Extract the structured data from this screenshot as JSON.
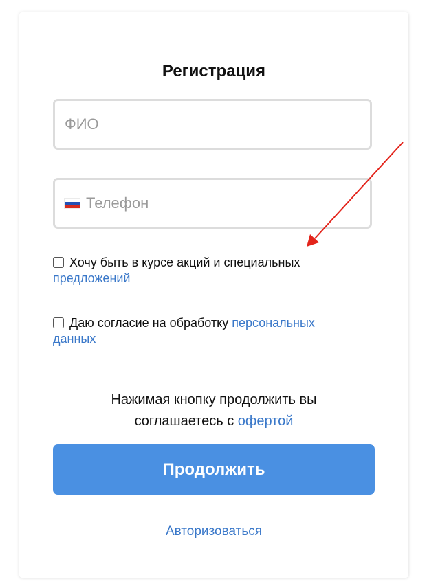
{
  "form": {
    "title": "Регистрация",
    "name_placeholder": "ФИО",
    "phone_placeholder": "Телефон",
    "checkbox_promo": {
      "text": "Хочу быть в курсе акций и специальных",
      "link": "предложений",
      "checked": false
    },
    "checkbox_consent": {
      "text": "Даю согласие на обработку",
      "link": "персональных данных",
      "checked": false
    },
    "offer": {
      "line1": "Нажимая кнопку продолжить вы",
      "line2": "соглашаетесь с",
      "link": "офертой"
    },
    "continue_label": "Продолжить",
    "login_label": "Авторизоваться"
  },
  "colors": {
    "accent": "#4a90e2",
    "link": "#3a78c9",
    "annotation_arrow": "#e3241b",
    "flag_white": "#ffffff",
    "flag_blue": "#2250b5",
    "flag_red": "#d52b1e"
  },
  "icons": {
    "phone_country": "russia-flag-icon"
  }
}
